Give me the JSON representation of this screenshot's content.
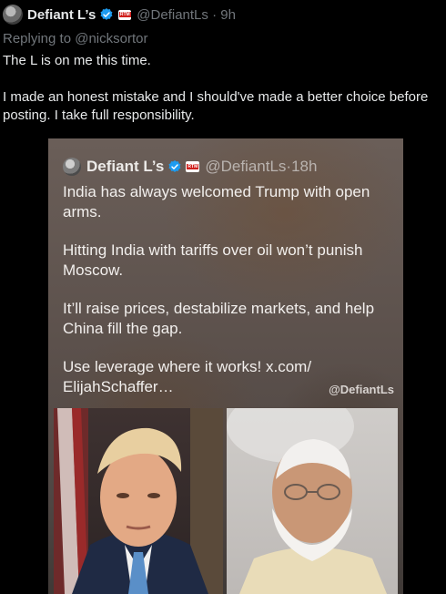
{
  "tweet": {
    "author_name": "Defiant L’s",
    "author_handle": "@DefiantLs",
    "separator": "·",
    "time": "9h",
    "replying_to_prefix": "Replying to",
    "replying_to_handle": "@nicksortor",
    "lines": [
      "The L is on me this time.",
      "I made an honest mistake and I should've made a better choice before posting. I take full responsibility."
    ]
  },
  "media": {
    "quoted": {
      "author_name": "Defiant L’s",
      "author_handle": "@DefiantLs",
      "separator": "·",
      "time": "18h",
      "paragraphs": [
        "India has always welcomed Trump with open arms.",
        "Hitting India with tariffs over oil won’t punish Moscow.",
        "It’ll raise prices, destabilize markets, and help China fill the gap.",
        "Use leverage where it works! x.com/ ElijahSchaffer…"
      ]
    },
    "watermark": "@DefiantLs",
    "affiliate_badge_text": "RTM",
    "photos": [
      "portrait-left-man-suit",
      "portrait-right-man-white-beard"
    ]
  },
  "icons": {
    "verified": "verified-badge-icon",
    "avatar": "avatar"
  },
  "colors": {
    "background": "#000000",
    "text_primary": "#e7e9ea",
    "text_secondary": "#71767b",
    "verified_blue": "#1d9bf0",
    "badge_red": "#d0201c"
  }
}
